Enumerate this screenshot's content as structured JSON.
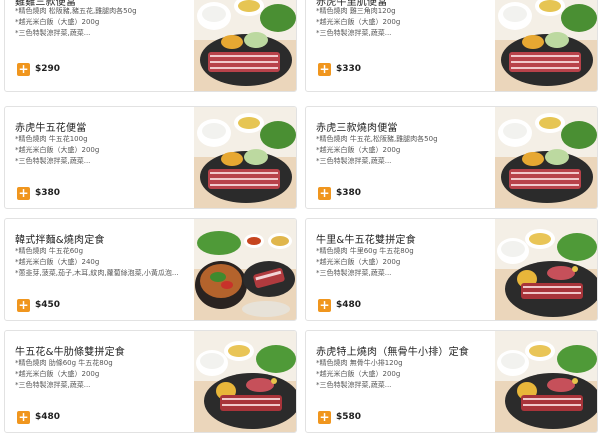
{
  "currency_add_icon": "plus-icon",
  "accent_color": "#f0961e",
  "items": [
    {
      "title": "雞雞三款便當",
      "lines": [
        "*精色燒肉 松阪豬,豬五花,雞腿肉各50g",
        "*越光米白飯（大盛）200g",
        "*三色特製涼拌菜,蔬菜..."
      ],
      "price": "$290"
    },
    {
      "title": "赤虎牛里肌便當",
      "lines": [
        "*精色燒肉 雞三角肉120g",
        "*越光米白飯（大盛）200g",
        "*三色特製涼拌菜,蔬菜..."
      ],
      "price": "$330"
    },
    {
      "title": "赤虎牛五花便當",
      "lines": [
        "*精色燒肉 牛五花100g",
        "*越光米白飯（大盛）200g",
        "*三色特製涼拌菜,蔬菜..."
      ],
      "price": "$380"
    },
    {
      "title": "赤虎三款燒肉便當",
      "lines": [
        "*精色燒肉 牛五花,松阪豬,雞腿肉各50g",
        "*越光米白飯（大盛）200g",
        "*三色特製涼拌菜,蔬菜..."
      ],
      "price": "$380"
    },
    {
      "title": "韓式拌麵&燒肉定食",
      "lines": [
        "*精色燒肉 牛五花60g",
        "*越光米白飯（大盛）240g",
        "*蔥韭芽,菠菜,茄子,木耳,紋肉,蘿蔔絲泡菜,小黃瓜泡..."
      ],
      "price": "$450"
    },
    {
      "title": "牛里&牛五花雙拼定食",
      "lines": [
        "*精色燒肉 牛里60g 牛五花80g",
        "*越光米白飯（大盛）200g",
        "*三色特製涼拌菜,蔬菜..."
      ],
      "price": "$480"
    },
    {
      "title": "牛五花&牛肋條雙拼定食",
      "lines": [
        "*精色燒肉 肋條60g 牛五花80g",
        "*越光米白飯（大盛）200g",
        "*三色特製涼拌菜,蔬菜..."
      ],
      "price": "$480"
    },
    {
      "title": "赤虎特上燒肉（無骨牛小排）定食",
      "lines": [
        "*精色燒肉 無骨牛小排120g",
        "*越光米白飯（大盛）200g",
        "*三色特製涼拌菜,蔬菜..."
      ],
      "price": "$580"
    }
  ]
}
